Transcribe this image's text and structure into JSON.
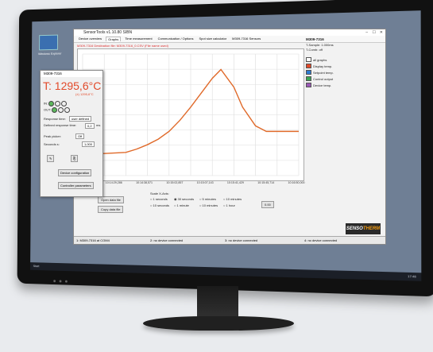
{
  "desktop": {
    "icon_label": "Windows Explorer",
    "taskbar_items": [
      "Start",
      "Search",
      "SensorTools"
    ],
    "clock": "17:46"
  },
  "app": {
    "title": "SensorTools v1.10.80 SIBN",
    "tabs": [
      "Device overview",
      "Graphs",
      "Time measurement",
      "Communication / Options",
      "Spot size calculator",
      "M309-7316 Sensors"
    ],
    "active_tab": "Graphs",
    "alert": "M309-7316 Destination file: M309-7316_0.CSV (File name used)",
    "win_controls": [
      "–",
      "☐",
      "✕"
    ],
    "right_panel": {
      "title": "M309-7316",
      "lines": [
        "T-Sample: 1.000ms",
        "T-Comb: off"
      ],
      "legend_all": "all graphs",
      "legend": [
        {
          "label": "Display temp.",
          "color": "#e24a2a"
        },
        {
          "label": "Setpoint temp.",
          "color": "#2e7ad1"
        },
        {
          "label": "Control output",
          "color": "#3aa655"
        },
        {
          "label": "Device temp.",
          "color": "#9b59b6"
        }
      ]
    },
    "x_ticks": [
      "10:13:20,000",
      "10:14:29,286",
      "10:14:38,571",
      "10:15:02,857",
      "10:15:07,143",
      "10:15:41,429",
      "10:15:45,714",
      "10:16:50,000"
    ],
    "controls": {
      "open_data_file": "Open data file",
      "copy_data_file": "Copy data file",
      "time_label": "Time",
      "scale_label": "Scale X-Axis:",
      "radios": [
        "1 seconds",
        "30 seconds",
        "5 minutes",
        "10 minutes",
        "10 seconds",
        "1 minute",
        "10 minutes",
        "1 hour"
      ],
      "value": "0.00"
    },
    "status": [
      "1: M309-7316 at COM4",
      "2: no device connected",
      "3: no device connected",
      "4: no device connected"
    ],
    "logo_text": "SENSO",
    "logo_accent": "THERM"
  },
  "device": {
    "title": "M309-7316",
    "temp_prefix": "T:",
    "temp_value": "1295,6°C",
    "temp_sub": "(±) 1295,6°C",
    "rows": {
      "in_label": "IN:",
      "out_label": "OUT:",
      "response_label": "Response time:",
      "response_value": "user defined",
      "defined_label": "Defined response time:",
      "defined_value": "0,2",
      "defined_unit": "ms",
      "peak_label": "Peak picker:",
      "peak_value": "Off",
      "seconds_label": "Seconds s:",
      "seconds_value": "1,000",
      "device_config": "Device configuration",
      "controller_params": "Controller parameters"
    }
  },
  "chart_data": {
    "type": "line",
    "title": "",
    "xlabel": "",
    "ylabel": "",
    "grid": true,
    "series": [
      {
        "color": "#e06a2a",
        "x": [
          0,
          10,
          20,
          25,
          30,
          35,
          40,
          45,
          50,
          55,
          60,
          64,
          70,
          74,
          80,
          85,
          90,
          100
        ],
        "y": [
          20,
          20,
          21,
          24,
          28,
          33,
          40,
          50,
          62,
          75,
          88,
          96,
          80,
          62,
          45,
          40,
          40,
          40
        ]
      }
    ],
    "ylim": [
      0,
      110
    ],
    "xlim": [
      0,
      100
    ]
  }
}
